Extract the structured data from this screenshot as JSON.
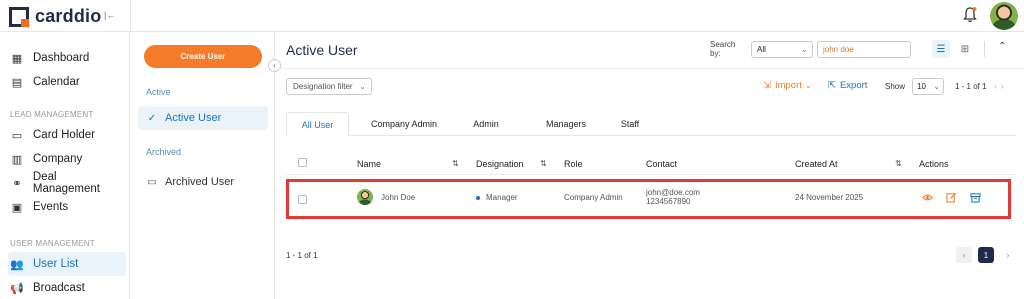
{
  "app": {
    "logo_text": "carddio",
    "collapse_glyph": "|←"
  },
  "nav": {
    "items_top": [
      {
        "label": "Dashboard",
        "icon": "dashboard-icon"
      },
      {
        "label": "Calendar",
        "icon": "calendar-icon"
      }
    ],
    "section_lead": "LEAD MANAGEMENT",
    "items_lead": [
      {
        "label": "Card Holder",
        "icon": "card-icon"
      },
      {
        "label": "Company",
        "icon": "company-icon"
      },
      {
        "label": "Deal Management",
        "icon": "handshake-icon"
      },
      {
        "label": "Events",
        "icon": "events-icon"
      }
    ],
    "section_user": "USER MANAGEMENT",
    "items_user": [
      {
        "label": "User List",
        "icon": "users-icon",
        "active": true
      },
      {
        "label": "Broadcast",
        "icon": "megaphone-icon"
      }
    ]
  },
  "midpanel": {
    "create_button": "Create User",
    "section_active": "Active",
    "item_active": "Active User",
    "section_archived": "Archived",
    "item_archived": "Archived User"
  },
  "main": {
    "title": "Active User",
    "search_label": "Search by:",
    "search_field_select": "All",
    "search_value": "john doe",
    "designation_filter": "Designation filter",
    "import_label": "Import",
    "export_label": "Export",
    "show_label": "Show",
    "page_size": "10",
    "range_top": "1 - 1 of 1",
    "range_bottom": "1 - 1 of 1",
    "current_page": "1"
  },
  "tabs": [
    "All User",
    "Company Admin",
    "Admin",
    "Managers",
    "Staff"
  ],
  "table": {
    "columns": [
      "Name",
      "Designation",
      "Role",
      "Contact",
      "Created At",
      "Actions"
    ],
    "rows": [
      {
        "name": "John Doe",
        "designation": "Manager",
        "role": "Company Admin",
        "email": "john@doe.com",
        "phone": "1234567890",
        "created_at": "24 November 2025"
      }
    ]
  },
  "colors": {
    "brand_orange": "#f47b2a",
    "brand_blue": "#1a73b8",
    "brand_navy": "#1f2b4a",
    "highlight_red": "#e53935"
  }
}
